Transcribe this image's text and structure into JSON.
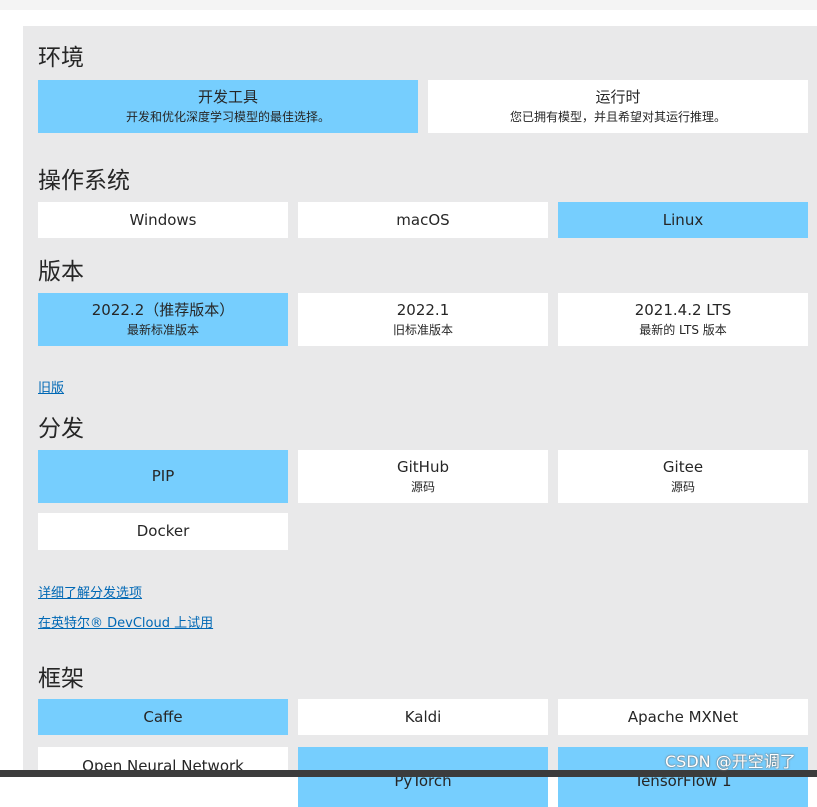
{
  "sections": {
    "env": {
      "title": "环境",
      "options": [
        {
          "label": "开发工具",
          "sub": "开发和优化深度学习模型的最佳选择。",
          "selected": true
        },
        {
          "label": "运行时",
          "sub": "您已拥有模型，并且希望对其运行推理。",
          "selected": false
        }
      ]
    },
    "os": {
      "title": "操作系统",
      "options": [
        {
          "label": "Windows",
          "selected": false
        },
        {
          "label": "macOS",
          "selected": false
        },
        {
          "label": "Linux",
          "selected": true
        }
      ]
    },
    "version": {
      "title": "版本",
      "options": [
        {
          "label": "2022.2（推荐版本）",
          "sub": "最新标准版本",
          "selected": true
        },
        {
          "label": "2022.1",
          "sub": "旧标准版本",
          "selected": false
        },
        {
          "label": "2021.4.2 LTS",
          "sub": "最新的 LTS 版本",
          "selected": false
        }
      ],
      "old_link": "旧版"
    },
    "dist": {
      "title": "分发",
      "options": [
        {
          "label": "PIP",
          "selected": true
        },
        {
          "label": "GitHub",
          "sub": "源码",
          "selected": false
        },
        {
          "label": "Gitee",
          "sub": "源码",
          "selected": false
        },
        {
          "label": "Docker",
          "selected": false
        }
      ],
      "learn_link": "详细了解分发选项",
      "devcloud_link": "在英特尔® DevCloud 上试用"
    },
    "framework": {
      "title": "框架",
      "options": [
        {
          "label": "Caffe",
          "selected": true
        },
        {
          "label": "Kaldi",
          "selected": false
        },
        {
          "label": "Apache MXNet",
          "selected": false
        },
        {
          "label": "Open Neural Network",
          "selected": false
        },
        {
          "label": "PyTorch",
          "selected": true
        },
        {
          "label": "TensorFlow 1",
          "selected": true
        }
      ]
    }
  },
  "watermark": "CSDN @开空调了"
}
